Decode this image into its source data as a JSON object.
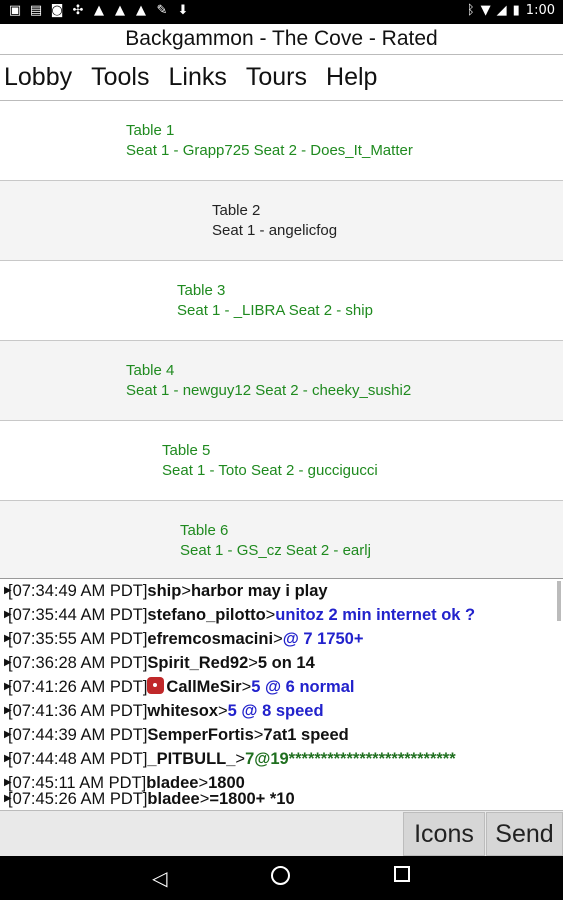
{
  "status_bar": {
    "left_icons": [
      "gallery-icon",
      "image-icon",
      "voicemail-icon",
      "usb-icon",
      "warning-icon",
      "warning-icon",
      "warning-icon",
      "wrench-icon",
      "download-icon"
    ],
    "right_icons": [
      "bluetooth-icon",
      "wifi-icon",
      "signal-icon",
      "battery-icon"
    ],
    "time": "1:00"
  },
  "title": "Backgammon - The Cove - Rated",
  "menu": {
    "items": [
      "Lobby",
      "Tools",
      "Links",
      "Tours",
      "Help"
    ]
  },
  "tables": [
    {
      "title": "Table 1",
      "seats": "Seat 1 - Grapp725 Seat 2 - Does_It_Matter",
      "color": "#1f8a1f"
    },
    {
      "title": "Table 2",
      "seats": "Seat 1 - angelicfog",
      "color": "#222222"
    },
    {
      "title": "Table 3",
      "seats": "Seat 1 - _LIBRA Seat 2 - ship",
      "color": "#1f8a1f"
    },
    {
      "title": "Table 4",
      "seats": "Seat 1 - newguy12 Seat 2 - cheeky_sushi2",
      "color": "#1f8a1f"
    },
    {
      "title": "Table 5",
      "seats": "Seat 1 - Toto Seat 2 - guccigucci",
      "color": "#1f8a1f"
    },
    {
      "title": "Table 6",
      "seats": "Seat 1 - GS_cz Seat 2 - earlj",
      "color": "#1f8a1f"
    }
  ],
  "chat": {
    "lines": [
      {
        "ts": "[07:34:49 AM PDT]",
        "user": "ship",
        "sep": ">",
        "msg": "harbor may i play",
        "style": "black"
      },
      {
        "ts": "[07:35:44 AM PDT]",
        "user": "stefano_pilotto",
        "sep": ">",
        "msg": "unitoz 2 min internet ok ?",
        "style": "blue"
      },
      {
        "ts": "[07:35:55 AM PDT]",
        "user": "efremcosmacini",
        "sep": ">",
        "msg": "@ 7 1750+",
        "style": "blue"
      },
      {
        "ts": "[07:36:28 AM PDT]",
        "user": "Spirit_Red92",
        "sep": ">",
        "msg": "5 on 14",
        "style": "black"
      },
      {
        "ts": "[07:41:26 AM PDT]",
        "user": "CallMeSir",
        "sep": ">",
        "msg": "5 @ 6 normal",
        "style": "blue",
        "dice": true
      },
      {
        "ts": "[07:41:36 AM PDT]",
        "user": "whitesox",
        "sep": ">",
        "msg": "5 @ 8 speed",
        "style": "blue"
      },
      {
        "ts": "[07:44:39 AM PDT]",
        "user": "SemperFortis",
        "sep": ">",
        "msg": "7at1 speed",
        "style": "black"
      },
      {
        "ts": "[07:44:48 AM PDT]",
        "user": "_PITBULL_",
        "sep": ">",
        "msg": "7@19**************************",
        "style": "green"
      },
      {
        "ts": "[07:45:11 AM PDT]",
        "user": "bladee",
        "sep": ">",
        "msg": "1800",
        "style": "black"
      },
      {
        "ts": "[07:45:26 AM PDT]",
        "user": "bladee",
        "sep": ">",
        "msg": "=1800+ *10",
        "style": "black"
      }
    ]
  },
  "input": {
    "value": "",
    "icons_label": "Icons",
    "send_label": "Send"
  }
}
